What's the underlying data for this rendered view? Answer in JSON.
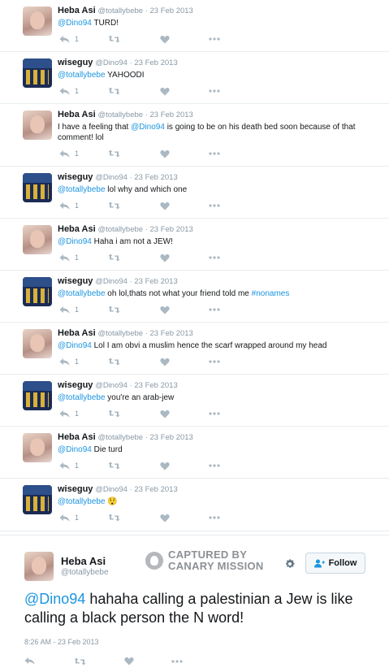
{
  "thread": [
    {
      "user": "heba",
      "name": "Heba Asi",
      "meta": "@totallybebe · 23 Feb 2013",
      "mention": "@Dino94",
      "body": " TURD!",
      "reply_count": "1"
    },
    {
      "user": "wise",
      "name": "wiseguy",
      "meta": "@Dino94 · 23 Feb 2013",
      "mention": "@totallybebe",
      "body": " YAHOODI",
      "reply_count": "1"
    },
    {
      "user": "heba",
      "name": "Heba Asi",
      "meta": "@totallybebe · 23 Feb 2013",
      "pre": "I have a feeling that ",
      "mention": "@Dino94",
      "body": " is going to be on his death bed soon because of that comment! lol",
      "reply_count": "1"
    },
    {
      "user": "wise",
      "name": "wiseguy",
      "meta": "@Dino94 · 23 Feb 2013",
      "mention": "@totallybebe",
      "body": " lol why and which one",
      "reply_count": "1"
    },
    {
      "user": "heba",
      "name": "Heba Asi",
      "meta": "@totallybebe · 23 Feb 2013",
      "mention": "@Dino94",
      "body": " Haha i am not a JEW!",
      "reply_count": "1"
    },
    {
      "user": "wise",
      "name": "wiseguy",
      "meta": "@Dino94 · 23 Feb 2013",
      "mention": "@totallybebe",
      "body": " oh lol,thats not what your friend told me ",
      "hashtag": "#nonames",
      "reply_count": "1"
    },
    {
      "user": "heba",
      "name": "Heba Asi",
      "meta": "@totallybebe · 23 Feb 2013",
      "mention": "@Dino94",
      "body": " Lol I am obvi a muslim hence the scarf wrapped around my head",
      "reply_count": "1"
    },
    {
      "user": "wise",
      "name": "wiseguy",
      "meta": "@Dino94 · 23 Feb 2013",
      "mention": "@totallybebe",
      "body": " you're an arab-jew",
      "reply_count": "1"
    },
    {
      "user": "heba",
      "name": "Heba Asi",
      "meta": "@totallybebe · 23 Feb 2013",
      "mention": "@Dino94",
      "body": " Die turd",
      "reply_count": "1"
    },
    {
      "user": "wise",
      "name": "wiseguy",
      "meta": "@Dino94 · 23 Feb 2013",
      "mention": "@totallybebe",
      "body": " 😲",
      "reply_count": "1"
    }
  ],
  "watermark": {
    "line1": "CAPTURED BY",
    "line2": "CANARY MISSION"
  },
  "main_tweet": {
    "name": "Heba Asi",
    "handle": "@totallybebe",
    "follow_label": "Follow",
    "mention": "@Dino94",
    "body": " hahaha calling a palestinian a Jew is like calling a black person the N word!",
    "timestamp": "8:26 AM - 23 Feb 2013"
  },
  "colors": {
    "link": "#1b95e0",
    "muted": "#8899a6",
    "icon": "#aab8c2"
  },
  "icons": [
    "reply-icon",
    "retweet-icon",
    "heart-icon",
    "more-icon",
    "gear-icon",
    "follow-user-icon",
    "canary-mission-logo"
  ]
}
